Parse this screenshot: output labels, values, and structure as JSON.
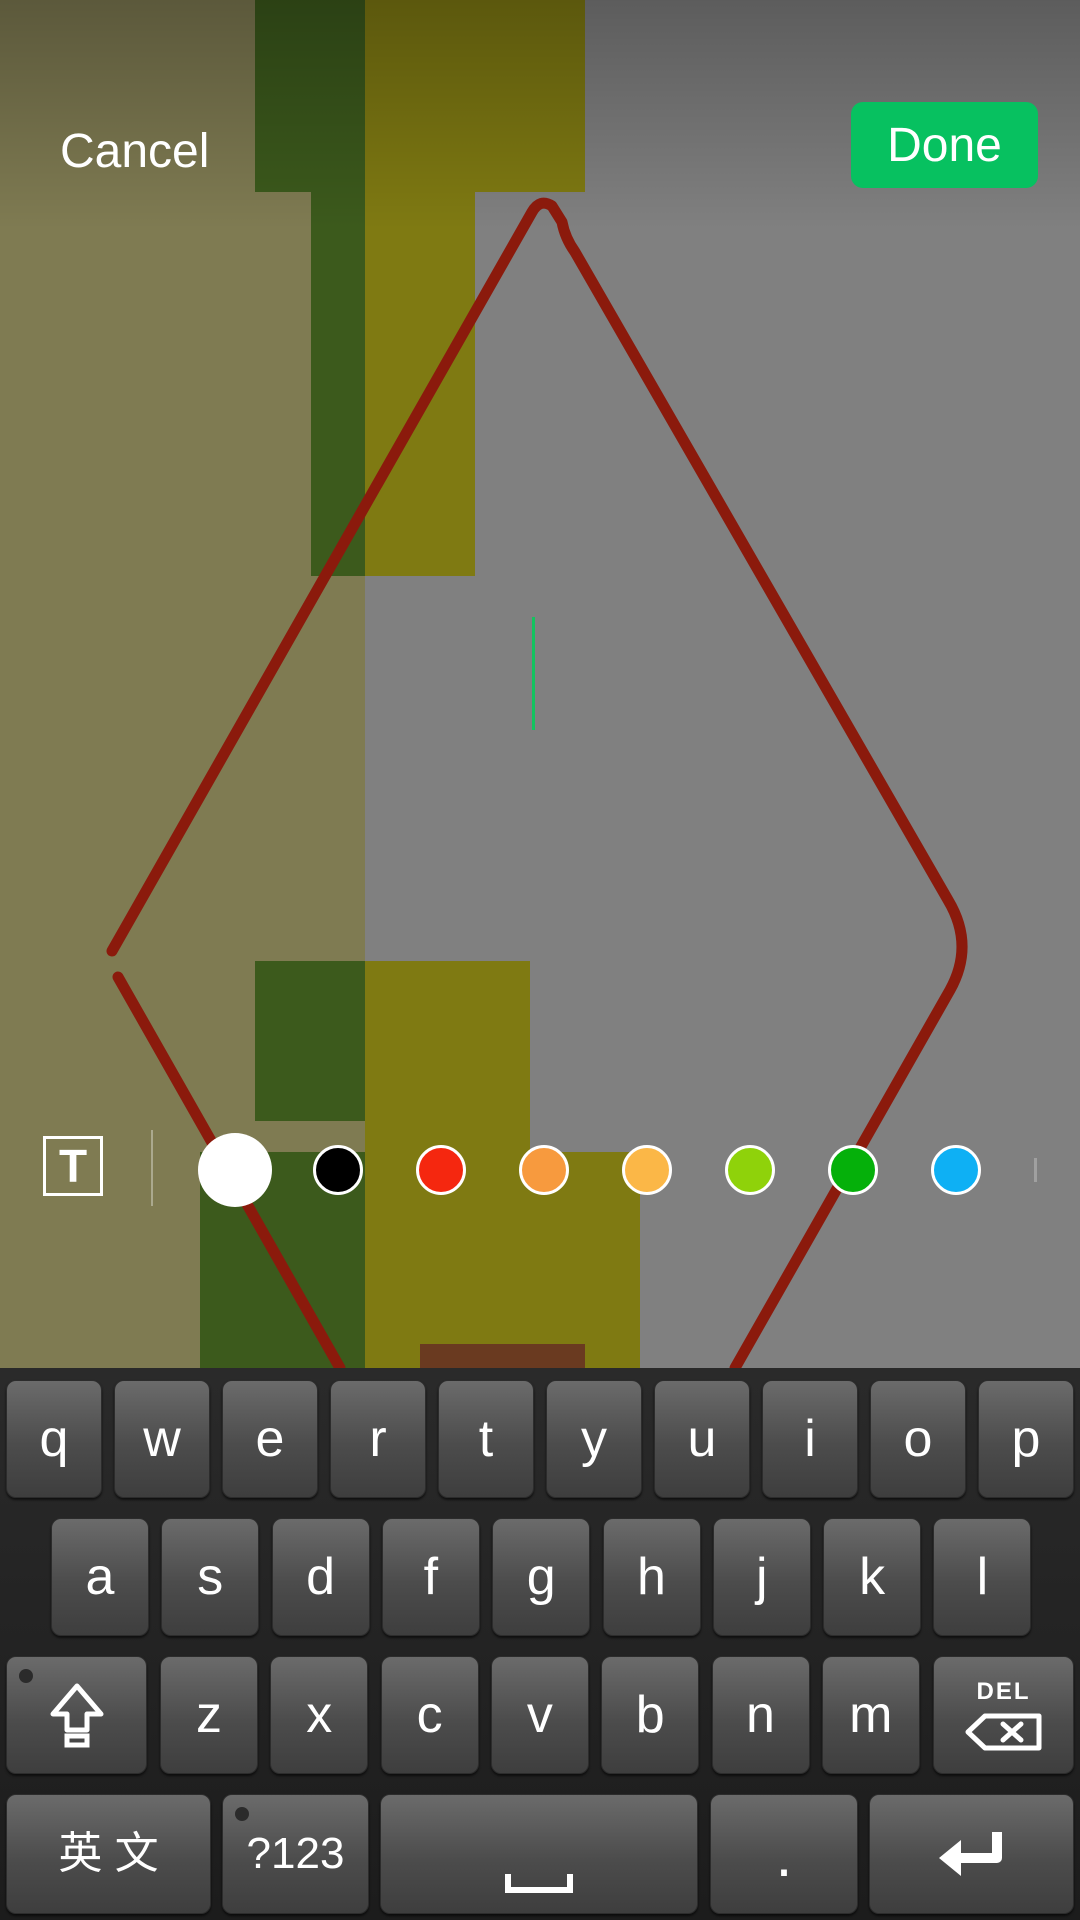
{
  "header": {
    "cancel_label": "Cancel",
    "done_label": "Done",
    "done_color": "#07c160"
  },
  "editor": {
    "stroke_color": "#8b1a0c",
    "cursor_color": "#12c45f"
  },
  "toolbar": {
    "text_tool_icon": "text-tool-icon",
    "text_tool_glyph": "T",
    "colors": [
      {
        "name": "white",
        "hex": "#ffffff",
        "selected": true
      },
      {
        "name": "black",
        "hex": "#000000",
        "selected": false
      },
      {
        "name": "red",
        "hex": "#f5270f",
        "selected": false
      },
      {
        "name": "orange",
        "hex": "#f79a3e",
        "selected": false
      },
      {
        "name": "amber",
        "hex": "#fbb747",
        "selected": false
      },
      {
        "name": "yellow-green",
        "hex": "#8fd20a",
        "selected": false
      },
      {
        "name": "green",
        "hex": "#05b00a",
        "selected": false
      },
      {
        "name": "blue",
        "hex": "#0eb0f4",
        "selected": false
      }
    ]
  },
  "keyboard": {
    "row1": [
      "q",
      "w",
      "e",
      "r",
      "t",
      "y",
      "u",
      "i",
      "o",
      "p"
    ],
    "row2": [
      "a",
      "s",
      "d",
      "f",
      "g",
      "h",
      "j",
      "k",
      "l"
    ],
    "row3": [
      "z",
      "x",
      "c",
      "v",
      "b",
      "n",
      "m"
    ],
    "shift_icon": "shift-arrow-icon",
    "delete_label": "DEL",
    "delete_icon": "backspace-icon",
    "lang_label": "英 文",
    "symbols_label": "?123",
    "space_icon": "space-bar-icon",
    "period_label": "·",
    "enter_icon": "enter-return-icon"
  }
}
